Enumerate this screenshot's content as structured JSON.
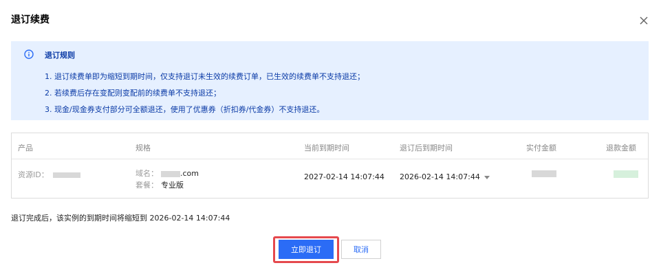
{
  "dialog": {
    "title": "退订续费",
    "close_icon": "close-icon"
  },
  "notice": {
    "icon": "info-icon",
    "title": "退订规则",
    "lines": [
      "1. 退订续费单即为缩短到期时间，仅支持退订未生效的续费订单，已生效的续费单不支持退还；",
      "2. 若续费后存在变配则变配前的续费单不支持退还；",
      "3. 现金/现金券支付部分可全额退还，使用了优惠券（折扣券/代金券）不支持退还。"
    ]
  },
  "table": {
    "headers": {
      "product": "产品",
      "spec": "规格",
      "current_expiry": "当前到期时间",
      "new_expiry": "退订后到期时间",
      "paid": "实付金额",
      "refund": "退款金额"
    },
    "row": {
      "resource_id_label": "资源ID：",
      "domain_label": "域名：",
      "domain_suffix": ".com",
      "package_label": "套餐：",
      "package_value": "专业版",
      "current_expiry": "2027-02-14 14:07:44",
      "new_expiry": "2026-02-14 14:07:44"
    }
  },
  "footer_note": "退订完成后，该实例的到期时间将缩短到 2026-02-14 14:07:44",
  "buttons": {
    "confirm": "立即退订",
    "cancel": "取消"
  },
  "colors": {
    "primary": "#2b6cf6",
    "notice_bg": "#e6f0ff",
    "notice_text": "#0a3aa6",
    "focus_ring": "#e5484d"
  }
}
